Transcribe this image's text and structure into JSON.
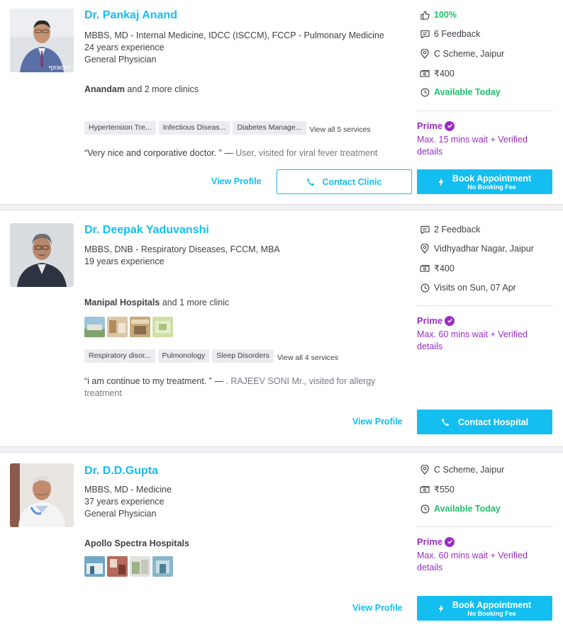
{
  "doctors": [
    {
      "name": "Dr. Pankaj Anand",
      "photo_watermark": "•practo•",
      "qualifications": "MBBS, MD - Internal Medicine, IDCC (ISCCM), FCCP - Pulmonary Medicine",
      "experience": "24 years experience",
      "specialty": "General Physician",
      "clinic_name": "Anandam",
      "clinic_more": " and 2 more clinics",
      "services": [
        "Hypertension Tre...",
        "Infectious Diseas...",
        "Diabetes Manage..."
      ],
      "services_view_all": "View all 5 services",
      "review_text": "“Very nice and corporative doctor. ” — ",
      "review_meta": "User, visited for viral fever treatment",
      "rating": "100%",
      "feedback": "6 Feedback",
      "location": "C Scheme, Jaipur",
      "fee": "₹400",
      "availability": "Available Today",
      "prime_label": "Prime",
      "prime_info": "Max. 15 mins wait + Verified details",
      "view_profile": "View Profile",
      "contact_label": "Contact Clinic",
      "book_label": "Book Appointment",
      "book_sub": "No Booking Fee"
    },
    {
      "name": "Dr. Deepak Yaduvanshi",
      "qualifications": "MBBS, DNB - Respiratory Diseases, FCCM, MBA",
      "experience": "19 years experience",
      "clinic_name": "Manipal Hospitals",
      "clinic_more": " and 1 more clinic",
      "services": [
        "Respiratory disor...",
        "Pulmonology",
        "Sleep Disorders"
      ],
      "services_view_all": "View all 4 services",
      "review_text": "“i am continue to my treatment. ” — ",
      "review_meta": ". RAJEEV SONI Mr., visited for allergy treatment",
      "feedback": "2 Feedback",
      "location": "Vidhyadhar Nagar, Jaipur",
      "fee": "₹400",
      "availability": "Visits on Sun, 07 Apr",
      "prime_label": "Prime",
      "prime_info": "Max. 60 mins wait + Verified details",
      "view_profile": "View Profile",
      "contact_label": "Contact Hospital"
    },
    {
      "name": "Dr. D.D.Gupta",
      "qualifications": "MBBS, MD - Medicine",
      "experience": "37 years experience",
      "specialty": "General Physician",
      "clinic_name": "Apollo Spectra Hospitals",
      "location": "C Scheme, Jaipur",
      "fee": "₹550",
      "availability": "Available Today",
      "prime_label": "Prime",
      "prime_info": "Max. 60 mins wait + Verified details",
      "view_profile": "View Profile",
      "book_label": "Book Appointment",
      "book_sub": "No Booking Fee"
    }
  ],
  "colors": {
    "accent": "#14bef0",
    "available_green": "#1ec26b",
    "prime_purple": "#9a2dc4",
    "text": "#414146",
    "muted": "#787887"
  }
}
